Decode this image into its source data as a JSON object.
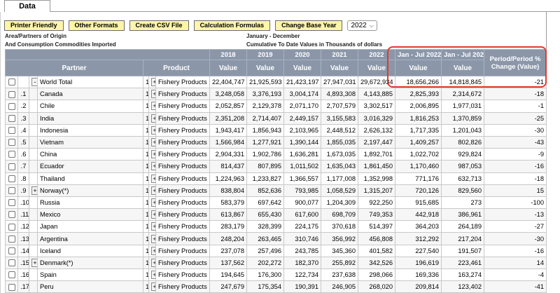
{
  "tab": {
    "label": "Data"
  },
  "toolbar": {
    "printer_friendly": "Printer Friendly",
    "other_formats": "Other Formats",
    "create_csv": "Create CSV File",
    "calc_formulas": "Calculation Formulas",
    "change_base_year": "Change Base Year",
    "year_value": "2022"
  },
  "meta": {
    "line1_left": "Area/Partners of Origin",
    "line2_left": "And Consumption Commodities Imported",
    "line1_right": "January - December",
    "line2_right": "Cumulative To Date Values in Thousands of dollars"
  },
  "headers": {
    "years": [
      "2018",
      "2019",
      "2020",
      "2021",
      "2022",
      "Jan - Jul 2022",
      "Jan - Jul 2023"
    ],
    "partner": "Partner",
    "product": "Product",
    "value": "Value",
    "change": "Period/Period % Change (Value)"
  },
  "rows": [
    {
      "idx": "",
      "pm": "-",
      "partner": "World Total",
      "pn": "1",
      "product": "Fishery Products",
      "v": [
        "22,404,747",
        "21,925,593",
        "21,423,197",
        "27,947,031",
        "29,672,934",
        "18,656,266",
        "14,818,845"
      ],
      "chg": "-21"
    },
    {
      "idx": ".1",
      "pm": "",
      "partner": "Canada",
      "pn": "1",
      "product": "Fishery Products",
      "v": [
        "3,248,058",
        "3,376,193",
        "3,004,174",
        "4,893,308",
        "4,143,885",
        "2,825,393",
        "2,314,672"
      ],
      "chg": "-18"
    },
    {
      "idx": ".2",
      "pm": "",
      "partner": "Chile",
      "pn": "1",
      "product": "Fishery Products",
      "v": [
        "2,052,857",
        "2,129,378",
        "2,071,170",
        "2,707,579",
        "3,302,517",
        "2,006,895",
        "1,977,031"
      ],
      "chg": "-1"
    },
    {
      "idx": ".3",
      "pm": "",
      "partner": "India",
      "pn": "1",
      "product": "Fishery Products",
      "v": [
        "2,351,208",
        "2,714,407",
        "2,449,157",
        "3,155,583",
        "3,016,329",
        "1,816,253",
        "1,370,859"
      ],
      "chg": "-25"
    },
    {
      "idx": ".4",
      "pm": "",
      "partner": "Indonesia",
      "pn": "1",
      "product": "Fishery Products",
      "v": [
        "1,943,417",
        "1,856,943",
        "2,103,965",
        "2,448,512",
        "2,626,132",
        "1,717,335",
        "1,201,043"
      ],
      "chg": "-30"
    },
    {
      "idx": ".5",
      "pm": "",
      "partner": "Vietnam",
      "pn": "1",
      "product": "Fishery Products",
      "v": [
        "1,566,984",
        "1,277,921",
        "1,390,144",
        "1,855,035",
        "2,197,447",
        "1,409,257",
        "802,826"
      ],
      "chg": "-43"
    },
    {
      "idx": ".6",
      "pm": "",
      "partner": "China",
      "pn": "1",
      "product": "Fishery Products",
      "v": [
        "2,904,331",
        "1,902,786",
        "1,636,281",
        "1,673,035",
        "1,892,701",
        "1,022,702",
        "929,824"
      ],
      "chg": "-9"
    },
    {
      "idx": ".7",
      "pm": "",
      "partner": "Ecuador",
      "pn": "1",
      "product": "Fishery Products",
      "v": [
        "814,437",
        "807,895",
        "1,011,502",
        "1,635,043",
        "1,861,450",
        "1,170,460",
        "987,053"
      ],
      "chg": "-16"
    },
    {
      "idx": ".8",
      "pm": "",
      "partner": "Thailand",
      "pn": "1",
      "product": "Fishery Products",
      "v": [
        "1,224,963",
        "1,233,827",
        "1,366,557",
        "1,177,008",
        "1,352,998",
        "771,176",
        "632,713"
      ],
      "chg": "-18"
    },
    {
      "idx": ".9",
      "pm": "+",
      "partner": "Norway(*)",
      "pn": "1",
      "product": "Fishery Products",
      "v": [
        "838,804",
        "852,636",
        "793,985",
        "1,058,529",
        "1,315,207",
        "720,126",
        "829,560"
      ],
      "chg": "15"
    },
    {
      "idx": ".10",
      "pm": "",
      "partner": "Russia",
      "pn": "1",
      "product": "Fishery Products",
      "v": [
        "583,379",
        "697,642",
        "900,077",
        "1,204,309",
        "922,250",
        "915,685",
        "273"
      ],
      "chg": "-100"
    },
    {
      "idx": ".11",
      "pm": "",
      "partner": "Mexico",
      "pn": "1",
      "product": "Fishery Products",
      "v": [
        "613,867",
        "655,430",
        "617,600",
        "698,709",
        "749,353",
        "442,918",
        "386,961"
      ],
      "chg": "-13"
    },
    {
      "idx": ".12",
      "pm": "",
      "partner": "Japan",
      "pn": "1",
      "product": "Fishery Products",
      "v": [
        "283,179",
        "328,399",
        "224,175",
        "370,618",
        "514,397",
        "364,203",
        "264,189"
      ],
      "chg": "-27"
    },
    {
      "idx": ".13",
      "pm": "",
      "partner": "Argentina",
      "pn": "1",
      "product": "Fishery Products",
      "v": [
        "248,204",
        "263,465",
        "310,746",
        "356,992",
        "456,808",
        "312,292",
        "217,204"
      ],
      "chg": "-30"
    },
    {
      "idx": ".14",
      "pm": "",
      "partner": "Iceland",
      "pn": "1",
      "product": "Fishery Products",
      "v": [
        "237,078",
        "257,496",
        "243,785",
        "345,360",
        "401,582",
        "227,540",
        "191,507"
      ],
      "chg": "-16"
    },
    {
      "idx": ".15",
      "pm": "+",
      "partner": "Denmark(*)",
      "pn": "1",
      "product": "Fishery Products",
      "v": [
        "137,562",
        "202,272",
        "182,370",
        "255,892",
        "342,526",
        "196,619",
        "223,461"
      ],
      "chg": "14"
    },
    {
      "idx": ".16",
      "pm": "",
      "partner": "Spain",
      "pn": "1",
      "product": "Fishery Products",
      "v": [
        "194,645",
        "176,300",
        "122,734",
        "237,638",
        "298,066",
        "169,336",
        "163,274"
      ],
      "chg": "-4"
    },
    {
      "idx": ".17",
      "pm": "",
      "partner": "Peru",
      "pn": "1",
      "product": "Fishery Products",
      "v": [
        "247,679",
        "175,354",
        "190,391",
        "246,905",
        "268,020",
        "209,814",
        "123,402"
      ],
      "chg": "-41"
    }
  ]
}
